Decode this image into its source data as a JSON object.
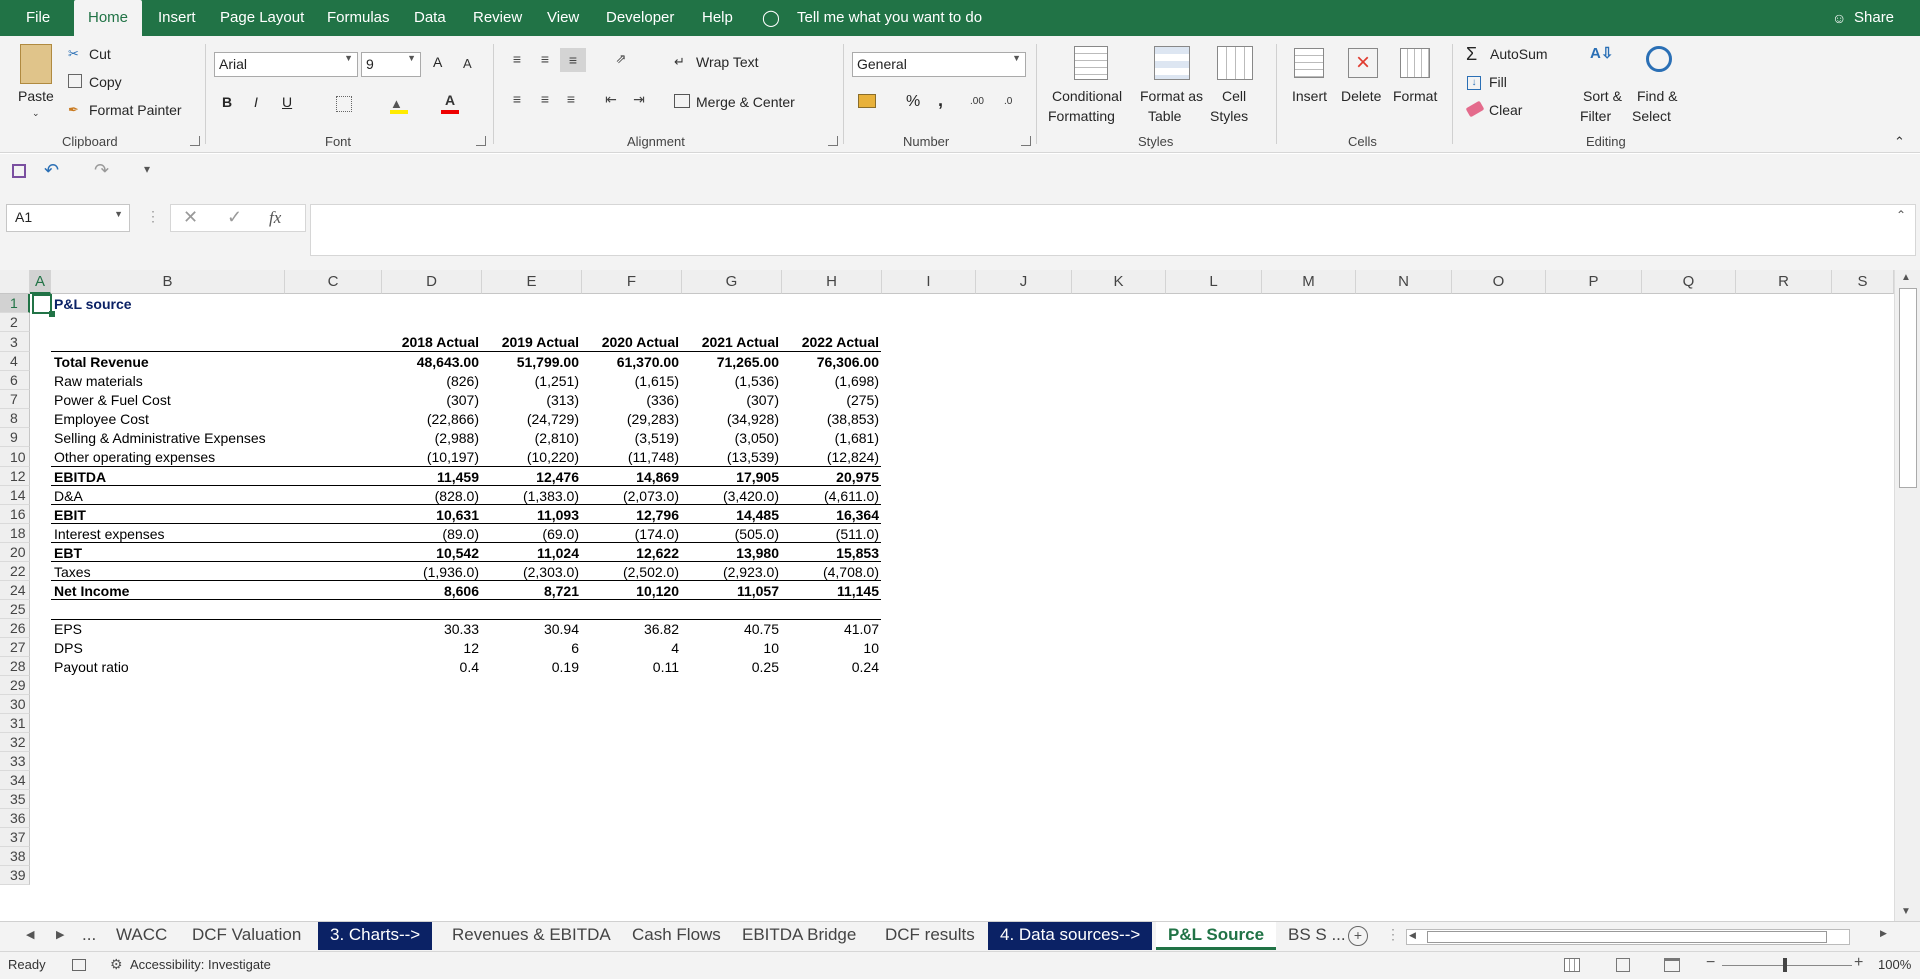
{
  "ribbon_tabs": [
    "File",
    "Home",
    "Insert",
    "Page Layout",
    "Formulas",
    "Data",
    "Review",
    "View",
    "Developer",
    "Help"
  ],
  "tell_me": "Tell me what you want to do",
  "share": "Share",
  "clipboard": {
    "paste": "Paste",
    "cut": "Cut",
    "copy": "Copy",
    "format_painter": "Format Painter",
    "group": "Clipboard"
  },
  "font": {
    "name": "Arial",
    "size": "9",
    "bold": "B",
    "italic": "I",
    "underline": "U",
    "group": "Font",
    "grow": "A",
    "shrink": "A"
  },
  "alignment": {
    "wrap": "Wrap Text",
    "merge": "Merge & Center",
    "group": "Alignment"
  },
  "number": {
    "format": "General",
    "percent": "%",
    "comma": ",",
    "inc": ".00",
    "dec": ".0",
    "group": "Number"
  },
  "styles": {
    "cond1": "Conditional",
    "cond2": "Formatting",
    "fmt1": "Format as",
    "fmt2": "Table",
    "cell1": "Cell",
    "cell2": "Styles",
    "group": "Styles"
  },
  "cells": {
    "insert": "Insert",
    "delete": "Delete",
    "format": "Format",
    "group": "Cells"
  },
  "editing": {
    "autosum": "AutoSum",
    "fill": "Fill",
    "clear": "Clear",
    "sort1": "Sort &",
    "sort2": "Filter",
    "find1": "Find &",
    "find2": "Select",
    "group": "Editing"
  },
  "name_box": "A1",
  "fx": "fx",
  "columns": [
    "A",
    "B",
    "C",
    "D",
    "E",
    "F",
    "G",
    "H",
    "I",
    "J",
    "K",
    "L",
    "M",
    "N",
    "O",
    "P",
    "Q",
    "R",
    "S"
  ],
  "row_numbers": [
    "1",
    "2",
    "3",
    "4",
    "6",
    "7",
    "8",
    "9",
    "10",
    "12",
    "14",
    "16",
    "18",
    "20",
    "22",
    "24",
    "25",
    "26",
    "27",
    "28",
    "29",
    "30",
    "31",
    "32",
    "33",
    "34",
    "35",
    "36",
    "37",
    "38",
    "39"
  ],
  "sheet": {
    "title": "P&L source",
    "years": [
      "2018 Actual",
      "2019 Actual",
      "2020 Actual",
      "2021 Actual",
      "2022 Actual"
    ],
    "rows": [
      {
        "label": "Total Revenue",
        "bold": true,
        "values": [
          "48,643.00",
          "51,799.00",
          "61,370.00",
          "71,265.00",
          "76,306.00"
        ]
      },
      {
        "label": "Raw materials",
        "bold": false,
        "values": [
          "(826)",
          "(1,251)",
          "(1,615)",
          "(1,536)",
          "(1,698)"
        ]
      },
      {
        "label": "Power & Fuel Cost",
        "bold": false,
        "values": [
          "(307)",
          "(313)",
          "(336)",
          "(307)",
          "(275)"
        ]
      },
      {
        "label": "Employee Cost",
        "bold": false,
        "values": [
          "(22,866)",
          "(24,729)",
          "(29,283)",
          "(34,928)",
          "(38,853)"
        ]
      },
      {
        "label": "Selling & Administrative Expenses",
        "bold": false,
        "values": [
          "(2,988)",
          "(2,810)",
          "(3,519)",
          "(3,050)",
          "(1,681)"
        ]
      },
      {
        "label": "Other operating expenses",
        "bold": false,
        "values": [
          "(10,197)",
          "(10,220)",
          "(11,748)",
          "(13,539)",
          "(12,824)"
        ]
      },
      {
        "label": "EBITDA",
        "bold": true,
        "values": [
          "11,459",
          "12,476",
          "14,869",
          "17,905",
          "20,975"
        ]
      },
      {
        "label": "D&A",
        "bold": false,
        "values": [
          "(828.0)",
          "(1,383.0)",
          "(2,073.0)",
          "(3,420.0)",
          "(4,611.0)"
        ]
      },
      {
        "label": "EBIT",
        "bold": true,
        "values": [
          "10,631",
          "11,093",
          "12,796",
          "14,485",
          "16,364"
        ]
      },
      {
        "label": "Interest expenses",
        "bold": false,
        "values": [
          "(89.0)",
          "(69.0)",
          "(174.0)",
          "(505.0)",
          "(511.0)"
        ]
      },
      {
        "label": "EBT",
        "bold": true,
        "values": [
          "10,542",
          "11,024",
          "12,622",
          "13,980",
          "15,853"
        ]
      },
      {
        "label": "Taxes",
        "bold": false,
        "values": [
          "(1,936.0)",
          "(2,303.0)",
          "(2,502.0)",
          "(2,923.0)",
          "(4,708.0)"
        ]
      },
      {
        "label": "Net Income",
        "bold": true,
        "values": [
          "8,606",
          "8,721",
          "10,120",
          "11,057",
          "11,145"
        ]
      },
      {
        "label": "EPS",
        "bold": false,
        "values": [
          "30.33",
          "30.94",
          "36.82",
          "40.75",
          "41.07"
        ]
      },
      {
        "label": "DPS",
        "bold": false,
        "values": [
          "12",
          "6",
          "4",
          "10",
          "10"
        ]
      },
      {
        "label": "Payout ratio",
        "bold": false,
        "values": [
          "0.4",
          "0.19",
          "0.11",
          "0.25",
          "0.24"
        ]
      }
    ]
  },
  "sheet_tabs": [
    {
      "label": "...",
      "style": "plain"
    },
    {
      "label": "WACC",
      "style": "plain"
    },
    {
      "label": "DCF Valuation",
      "style": "plain"
    },
    {
      "label": "3. Charts-->",
      "style": "dark"
    },
    {
      "label": "Revenues & EBITDA",
      "style": "plain"
    },
    {
      "label": "Cash Flows",
      "style": "plain"
    },
    {
      "label": "EBITDA Bridge",
      "style": "plain"
    },
    {
      "label": "DCF results",
      "style": "plain"
    },
    {
      "label": "4. Data sources-->",
      "style": "dark"
    },
    {
      "label": "P&L Source",
      "style": "active"
    },
    {
      "label": "BS S ...",
      "style": "plain"
    }
  ],
  "status": {
    "ready": "Ready",
    "accessibility": "Accessibility: Investigate",
    "zoom": "100%"
  }
}
